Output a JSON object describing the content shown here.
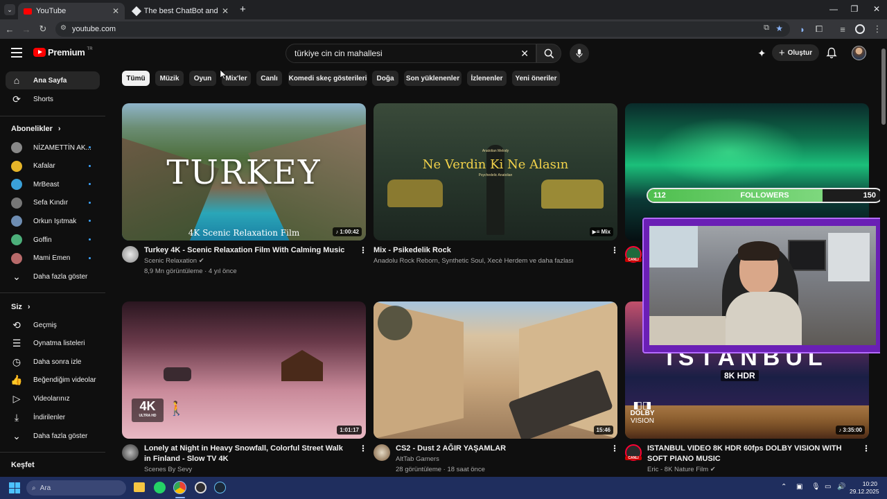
{
  "browser": {
    "tabs": [
      {
        "title": "YouTube",
        "active": true
      },
      {
        "title": "The best ChatBot and Widgets",
        "active": false
      }
    ],
    "url": "youtube.com"
  },
  "header": {
    "logo_text": "Premium",
    "logo_badge": "TR",
    "search_value": "türkiye cin cin mahallesi",
    "create_label": "Oluştur"
  },
  "chips": [
    "Tümü",
    "Müzik",
    "Oyun",
    "Mix'ler",
    "Canlı",
    "Komedi skeç gösterileri",
    "Doğa",
    "Son yüklenenler",
    "İzlenenler",
    "Yeni öneriler"
  ],
  "sidebar": {
    "main": [
      {
        "label": "Ana Sayfa",
        "icon": "home-icon"
      },
      {
        "label": "Shorts",
        "icon": "shorts-icon"
      }
    ],
    "subscriptions_heading": "Abonelikler",
    "subscriptions": [
      {
        "label": "NİZAMETTİN AK...",
        "color": "#888888"
      },
      {
        "label": "Kafalar",
        "color": "#e5b429"
      },
      {
        "label": "MrBeast",
        "color": "#3aa0d8"
      },
      {
        "label": "Sefa Kındır",
        "color": "#777777"
      },
      {
        "label": "Orkun Işıtmak",
        "color": "#6e8db2"
      },
      {
        "label": "Goffin",
        "color": "#4caf7a"
      },
      {
        "label": "Mami Emen",
        "color": "#b86a6a"
      }
    ],
    "show_more": "Daha fazla göster",
    "you_heading": "Siz",
    "you_items": [
      {
        "label": "Geçmiş",
        "icon": "history-icon"
      },
      {
        "label": "Oynatma listeleri",
        "icon": "playlist-icon"
      },
      {
        "label": "Daha sonra izle",
        "icon": "clock-icon"
      },
      {
        "label": "Beğendiğim videolar",
        "icon": "thumbs-up-icon"
      },
      {
        "label": "Videolarınız",
        "icon": "video-icon"
      },
      {
        "label": "İndirilenler",
        "icon": "download-icon"
      }
    ],
    "show_more_2": "Daha fazla göster",
    "explore_heading": "Keşfet"
  },
  "videos": [
    {
      "title": "Turkey 4K - Scenic Relaxation Film With Calming Music",
      "channel": "Scenic Relaxation",
      "stats": "8,9 Mn görüntüleme · 4 yıl önce",
      "duration": "1:00:42",
      "thumb_text": "TURKEY",
      "thumb_sub": "4K Scenic Relaxation Film"
    },
    {
      "title": "Mix - Psikedelik Rock",
      "channel": "Anadolu Rock Reborn, Synthetic Soul, Xecè Herdem ve daha fazlası",
      "stats": "",
      "duration": "Mix",
      "thumb_text": "Ne Verdin Ki Ne Alasın",
      "thumb_top": "Anatolian Melody",
      "thumb_sub": "Psychedelic Anatolian"
    },
    {
      "title": "",
      "channel": "",
      "stats": "",
      "duration": "",
      "live": "CANLI"
    },
    {
      "title": "Lonely at Night in Heavy Snowfall, Colorful Street Walk in Finland - Slow TV 4K",
      "channel": "Scenes By Sevy",
      "stats": "",
      "duration": "1:01:17",
      "badge": "4K",
      "badge_sub": "ULTRA HD"
    },
    {
      "title": "CS2 - Dust 2 AĞIR YAŞAMLAR",
      "channel": "AltTab Gamers",
      "stats": "28 görüntüleme · 18 saat önce",
      "duration": "15:46"
    },
    {
      "title": "ISTANBUL VIDEO 8K HDR 60fps DOLBY VISION WITH SOFT PIANO MUSIC",
      "channel": "Eric - 8K Nature Film",
      "stats": "",
      "duration": "3:35:00",
      "thumb_text": "ISTANBUL",
      "thumb_badge": "8K HDR",
      "dolby": "DOLBY",
      "dolby_sub": "VISION",
      "live": "CANLI"
    }
  ],
  "overlay": {
    "followers_current": "112",
    "followers_label": "FOLLOWERS",
    "followers_goal": "150",
    "progress": 0.747
  },
  "taskbar": {
    "search_placeholder": "Ara",
    "time": "10:20",
    "date": "29.12.2025"
  },
  "colors": {
    "background": "#0f0f0f",
    "accent_red": "#ff0000",
    "overlay_purple": "#6a1fb5",
    "followers_green": "#5cc95c"
  }
}
